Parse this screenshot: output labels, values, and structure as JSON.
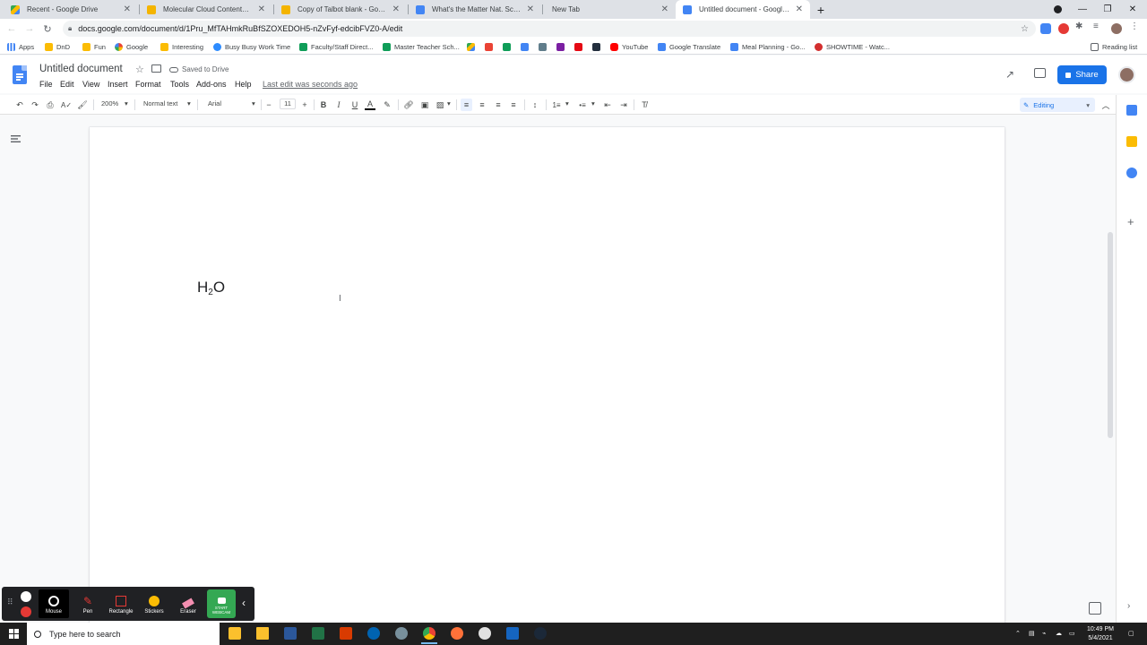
{
  "browser": {
    "tabs": [
      {
        "title": "Recent - Google Drive",
        "active": false
      },
      {
        "title": "Molecular Cloud Contents - Goo",
        "active": false
      },
      {
        "title": "Copy of Talbot blank - Google Sl",
        "active": false
      },
      {
        "title": "What's the Matter Nat. Sci. Plan",
        "active": false
      },
      {
        "title": "New Tab",
        "active": false
      },
      {
        "title": "Untitled document - Google Do",
        "active": true
      }
    ],
    "url": "docs.google.com/document/d/1Pru_MfTAHmkRuBfSZOXEDOH5-nZvFyf-edcibFVZ0-A/edit",
    "bookmarks": [
      "Apps",
      "DnD",
      "Fun",
      "Google",
      "Interesting",
      "Busy Busy Work Time",
      "Faculty/Staff Direct...",
      "Master Teacher Sch...",
      "YouTube",
      "Google Translate",
      "Meal Planning - Go...",
      "SHOWTIME - Watc..."
    ],
    "reading_list": "Reading list"
  },
  "docs": {
    "title": "Untitled document",
    "saved_status": "Saved to Drive",
    "menus": [
      "File",
      "Edit",
      "View",
      "Insert",
      "Format",
      "Tools",
      "Add-ons",
      "Help"
    ],
    "last_edit": "Last edit was seconds ago",
    "share_label": "Share",
    "toolbar": {
      "zoom": "200%",
      "style": "Normal text",
      "font": "Arial",
      "font_size": "11",
      "bold": "B",
      "italic": "I",
      "underline": "U",
      "text_color": "A",
      "mode": "Editing"
    },
    "content": {
      "formula_main": "H",
      "formula_sub": "2",
      "formula_tail": "O"
    }
  },
  "recorder": {
    "tools": [
      "Mouse",
      "Pen",
      "Rectangle",
      "Stickers",
      "Eraser"
    ],
    "webcam_label_1": "START",
    "webcam_label_2": "WEBCAM"
  },
  "taskbar": {
    "search_placeholder": "Type here to search",
    "time": "10:49 PM",
    "date": "5/4/2021"
  },
  "colors": {
    "accent": "#1a73e8",
    "docs_blue": "#4285f4",
    "taskbar": "#1f1f1f",
    "recorder_bg": "#202124",
    "webcam_green": "#34a853"
  }
}
